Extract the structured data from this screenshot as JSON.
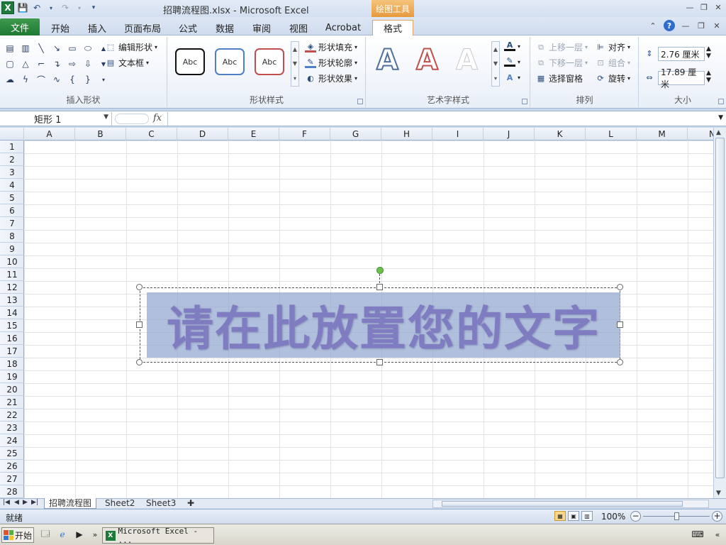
{
  "window": {
    "title": "招聘流程图.xlsx - Microsoft Excel",
    "context_tab_label": "绘图工具"
  },
  "tabs": [
    {
      "label": "文件"
    },
    {
      "label": "开始"
    },
    {
      "label": "插入"
    },
    {
      "label": "页面布局"
    },
    {
      "label": "公式"
    },
    {
      "label": "数据"
    },
    {
      "label": "审阅"
    },
    {
      "label": "视图"
    },
    {
      "label": "Acrobat"
    },
    {
      "label": "格式"
    }
  ],
  "ribbon": {
    "insert_shapes": {
      "label": "插入形状",
      "edit_shape": "编辑形状",
      "text_box": "文本框"
    },
    "shape_styles": {
      "label": "形状样式",
      "presets": [
        "Abc",
        "Abc",
        "Abc"
      ],
      "preset_colors": [
        "#111111",
        "#4f7fc4",
        "#c0504d"
      ],
      "fill": "形状填充",
      "outline": "形状轮廓",
      "effects": "形状效果"
    },
    "wordart_styles": {
      "label": "艺术字样式",
      "presets": [
        "A",
        "A",
        "A"
      ]
    },
    "arrange": {
      "label": "排列",
      "bring_forward": "上移一层",
      "send_backward": "下移一层",
      "selection_pane": "选择窗格",
      "align": "对齐",
      "group": "组合",
      "rotate": "旋转"
    },
    "size": {
      "label": "大小",
      "height": "2.76 厘米",
      "width": "17.89 厘米"
    }
  },
  "formula_bar": {
    "name_box": "矩形 1",
    "fx": "fx",
    "formula": ""
  },
  "columns": [
    "A",
    "B",
    "C",
    "D",
    "E",
    "F",
    "G",
    "H",
    "I",
    "J",
    "K",
    "L",
    "M",
    "N"
  ],
  "rows": [
    "1",
    "2",
    "3",
    "4",
    "5",
    "6",
    "7",
    "8",
    "9",
    "10",
    "11",
    "12",
    "13",
    "14",
    "15",
    "16",
    "17",
    "18",
    "19",
    "20",
    "21",
    "22",
    "23",
    "24",
    "25",
    "26",
    "27",
    "28"
  ],
  "shape": {
    "text": "请在此放置您的文字",
    "fill_color": "#96aad0",
    "text_color": "#7f7cc2"
  },
  "sheet_tabs": [
    {
      "label": "招聘流程图",
      "active": true
    },
    {
      "label": "Sheet2",
      "active": false
    },
    {
      "label": "Sheet3",
      "active": false
    }
  ],
  "status": {
    "ready": "就绪",
    "zoom": "100%"
  },
  "taskbar": {
    "start_label": "开始",
    "excel_task": "Microsoft Excel - ..."
  }
}
